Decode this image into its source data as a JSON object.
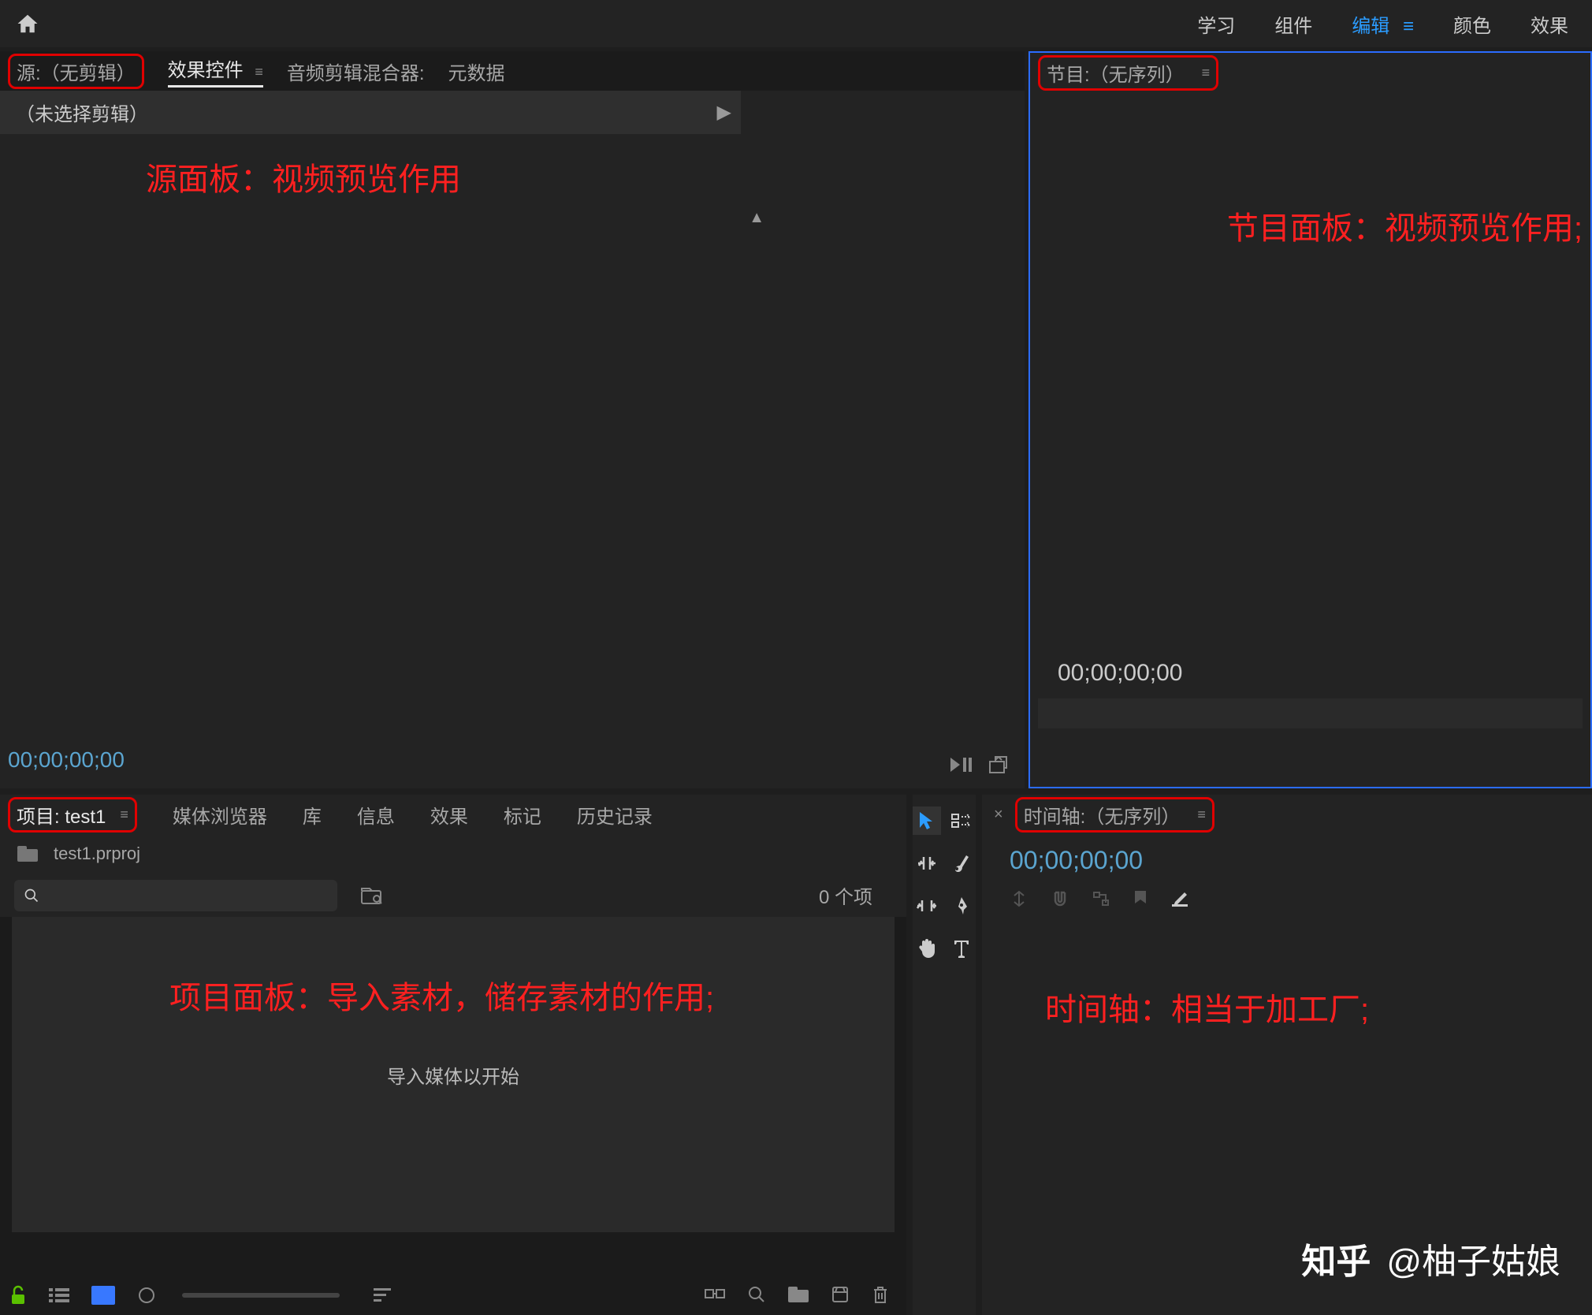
{
  "workspace_tabs": {
    "learn": "学习",
    "assembly": "组件",
    "edit": "编辑",
    "color": "颜色",
    "effects": "效果"
  },
  "source": {
    "tab_source": "源:（无剪辑）",
    "tab_effect_controls": "效果控件",
    "tab_audio_mixer": "音频剪辑混合器:",
    "tab_metadata": "元数据",
    "status": "（未选择剪辑）",
    "timecode": "00;00;00;00",
    "annotation": "源面板：视频预览作用"
  },
  "program": {
    "tab_program": "节目:（无序列）",
    "timecode": "00;00;00;00",
    "annotation": "节目面板：视频预览作用;"
  },
  "project": {
    "tab_project": "项目: test1",
    "tab_media_browser": "媒体浏览器",
    "tab_library": "库",
    "tab_info": "信息",
    "tab_effects": "效果",
    "tab_markers": "标记",
    "tab_history": "历史记录",
    "file_name": "test1.prproj",
    "item_count": "0 个项",
    "import_hint": "导入媒体以开始",
    "annotation": "项目面板：导入素材，储存素材的作用;"
  },
  "timeline": {
    "tab_timeline": "时间轴:（无序列）",
    "timecode": "00;00;00;00",
    "annotation": "时间轴：相当于加工厂;"
  },
  "watermark": {
    "logo": "知乎",
    "author": "@柚子姑娘"
  }
}
